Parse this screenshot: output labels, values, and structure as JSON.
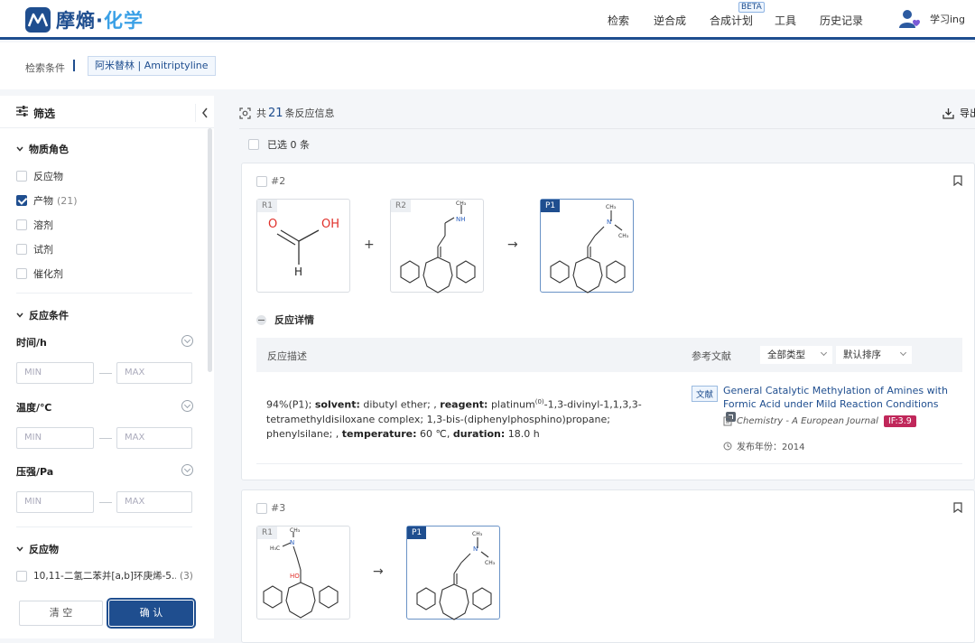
{
  "header": {
    "brand_main": "摩熵",
    "brand_accent": "化学",
    "nav": [
      {
        "label": "检索"
      },
      {
        "label": "逆合成"
      },
      {
        "label": "合成计划"
      },
      {
        "label": "工具"
      },
      {
        "label": "历史记录"
      }
    ],
    "beta_label": "BETA",
    "user_name": "学习ing"
  },
  "breadcrumb": {
    "label": "检索条件",
    "tag": "阿米替林 | Amitriptyline"
  },
  "sidebar": {
    "title": "筛选",
    "role_section": "物质角色",
    "roles": [
      {
        "label": "反应物",
        "count": "",
        "checked": false
      },
      {
        "label": "产物",
        "count": "(21)",
        "checked": true
      },
      {
        "label": "溶剂",
        "count": "",
        "checked": false
      },
      {
        "label": "试剂",
        "count": "",
        "checked": false
      },
      {
        "label": "催化剂",
        "count": "",
        "checked": false
      }
    ],
    "condition_section": "反应条件",
    "conditions": [
      {
        "label": "时间/h",
        "min_placeholder": "MIN",
        "max_placeholder": "MAX"
      },
      {
        "label": "温度/℃",
        "min_placeholder": "MIN",
        "max_placeholder": "MAX"
      },
      {
        "label": "压强/Pa",
        "min_placeholder": "MIN",
        "max_placeholder": "MAX"
      }
    ],
    "reactant_section": "反应物",
    "reactant_item": {
      "label": "10,11-二氢二苯并[a,b]环庚烯-5...",
      "count": "(3)"
    },
    "clear_label": "清 空",
    "confirm_label": "确 认"
  },
  "main": {
    "count_prefix": "共",
    "count": "21",
    "count_suffix": "条反应信息",
    "export_label": "导出",
    "selected_label": "已选 0 条",
    "reactions": [
      {
        "id": "#2",
        "molecules": [
          {
            "tag": "R1"
          },
          {
            "tag": "R2"
          },
          {
            "tag": "P1"
          }
        ],
        "details_label": "反应详情",
        "desc_header": "反应描述",
        "ref_header": "参考文献",
        "type_filter": "全部类型",
        "sort_filter": "默认排序",
        "description": {
          "yield": "94%(P1);",
          "solvent_key": "solvent:",
          "solvent": "dibutyl ether; ,",
          "reagent_key": "reagent:",
          "reagent_pre": "platinum",
          "reagent_sup": "(0)",
          "reagent_post": "-1,3-divinyl-1,1,3,3-tetramethyldisiloxane complex; 1,3-bis-(diphenylphosphino)propane; phenylsilane; ,",
          "temp_key": "temperature:",
          "temp": "60 ℃,",
          "duration_key": "duration:",
          "duration": "18.0 h"
        },
        "literature": {
          "badge": "文献",
          "title": "General Catalytic Methylation of Amines with Formic Acid under Mild Reaction Conditions",
          "journal": "Chemistry - A European Journal",
          "impact": "IF:3.9",
          "year": "发布年份：2014"
        }
      },
      {
        "id": "#3",
        "molecules": [
          {
            "tag": "R1"
          },
          {
            "tag": "P1"
          }
        ]
      }
    ]
  },
  "colors": {
    "brand": "#1f4e8f",
    "accent": "#3aa0e6",
    "impact_badge": "#c0275a"
  }
}
